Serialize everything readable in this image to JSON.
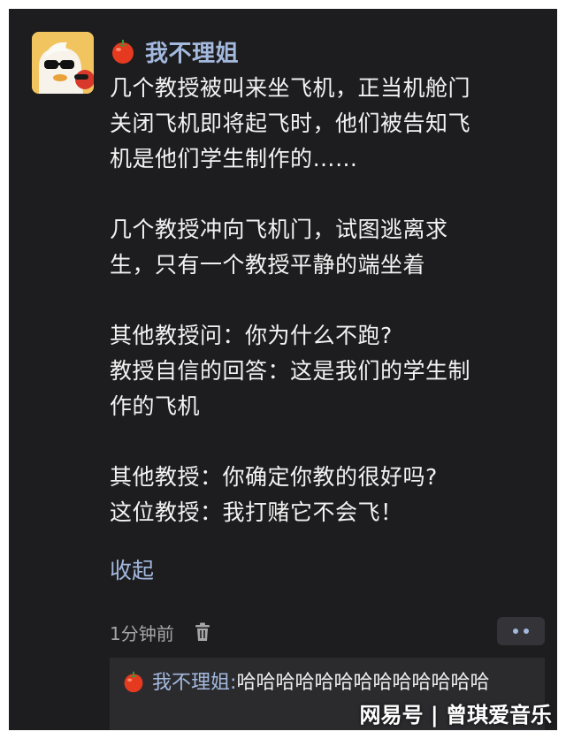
{
  "post": {
    "author": "我不理姐",
    "paragraphs": [
      [
        "几个教授被叫来坐飞机，正当机舱门",
        "关闭飞机即将起飞时，他们被告知飞",
        "机是他们学生制作的……"
      ],
      [
        "几个教授冲向飞机门，试图逃离求",
        "生，只有一个教授平静的端坐着"
      ],
      [
        "其他教授问：你为什么不跑?",
        "教授自信的回答：这是我们的学生制",
        "作的飞机"
      ],
      [
        "其他教授：你确定你教的很好吗?",
        "这位教授：我打赌它不会飞！"
      ]
    ],
    "collapse_label": "收起",
    "timestamp": "1分钟前"
  },
  "comment": {
    "author": "我不理姐",
    "separator": ":",
    "text": "哈哈哈哈哈哈哈哈哈哈哈哈哈"
  },
  "watermark": "网易号 | 曾琪爱音乐",
  "icons": {
    "author_badge": "tomato-icon",
    "delete": "trash-icon",
    "more": "more-dots-icon"
  },
  "colors": {
    "background": "#1d1d1f",
    "link": "#a3b9de",
    "text": "#f2f2f2",
    "muted": "#a6a6a6",
    "comment_bg": "#2b2b2e"
  }
}
